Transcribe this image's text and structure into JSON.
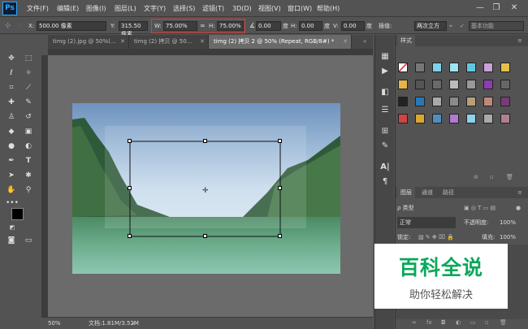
{
  "app": {
    "logo": "Ps"
  },
  "menu": [
    "文件(F)",
    "编辑(E)",
    "图像(I)",
    "图层(L)",
    "文字(Y)",
    "选择(S)",
    "滤镜(T)",
    "3D(D)",
    "视图(V)",
    "窗口(W)",
    "帮助(H)"
  ],
  "window_controls": {
    "minimize": "—",
    "restore": "❐",
    "close": "✕"
  },
  "options": {
    "x_label": "X:",
    "x_value": "500.00 像素",
    "y_label": "Y:",
    "y_value": "315.50 像素",
    "w_label": "W:",
    "w_value": "75.00%",
    "h_label": "H:",
    "h_value": "75.00%",
    "angle_value": "0.00",
    "angle_unit": "度",
    "h_skew_label": "H:",
    "h_skew_value": "0.00",
    "h_skew_unit": "度",
    "v_skew_label": "V:",
    "v_skew_value": "0.00",
    "v_skew_unit": "度",
    "interp_label": "插值:",
    "interp_value": "两次立方",
    "workspace": "基本功能"
  },
  "tabs": [
    {
      "label": "timg (2).jpg @ 50%(..."
    },
    {
      "label": "timg (2) 拷贝 @ 50..."
    },
    {
      "label": "timg (2) 拷贝 2 @ 50% (Repeat, RGB/8#) *",
      "active": true
    }
  ],
  "status": {
    "zoom": "50%",
    "doc": "文档:1.81M/3.52M"
  },
  "styles_panel": {
    "title": "样式"
  },
  "layers_panel": {
    "tabs": [
      "图层",
      "通道",
      "路径"
    ],
    "kind_label": "ρ 类型",
    "blend_mode": "正常",
    "opacity_label": "不透明度:",
    "opacity_value": "100%",
    "lock_label": "锁定:",
    "fill_label": "填充:",
    "fill_value": "100%"
  },
  "watermark": {
    "title": "百科全说",
    "subtitle": "助你轻松解决"
  },
  "colors": {
    "accent": "#31a8ff",
    "highlight": "#e03c3c",
    "watermark_green": "#0aa85a"
  }
}
